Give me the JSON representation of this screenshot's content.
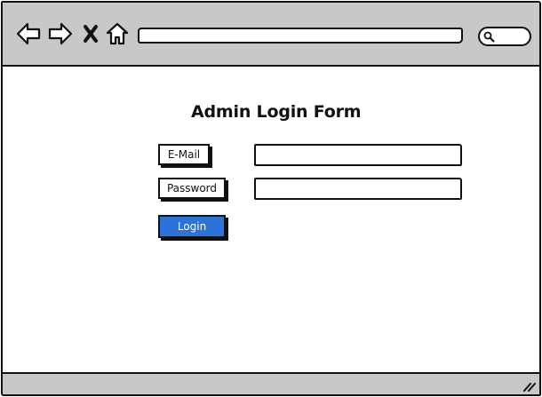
{
  "toolbar": {
    "back_icon": "back-arrow-icon",
    "forward_icon": "forward-arrow-icon",
    "stop_icon": "close-x-icon",
    "home_icon": "home-icon",
    "address_value": "",
    "search_icon": "search-icon",
    "search_value": ""
  },
  "form": {
    "title": "Admin Login Form",
    "email_label": "E-Mail",
    "email_value": "",
    "password_label": "Password",
    "password_value": "",
    "login_label": "Login"
  },
  "colors": {
    "chrome": "#c8c8c8",
    "accent": "#2a73d9",
    "outline": "#111111"
  }
}
